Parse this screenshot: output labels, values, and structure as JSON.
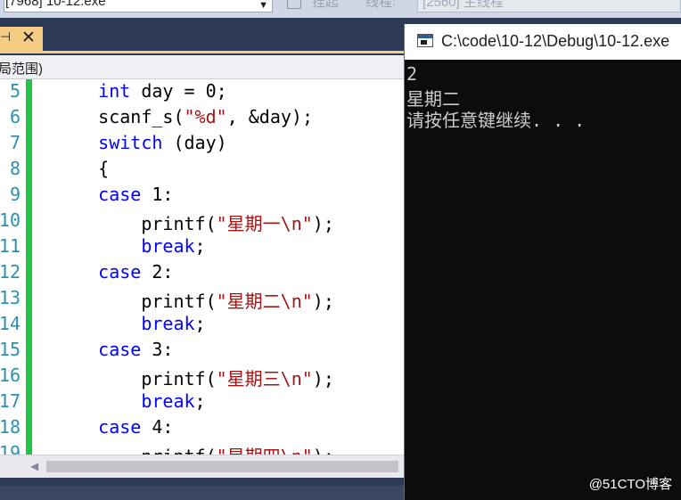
{
  "toolbar": {
    "process_label": "[7968] 10-12.exe",
    "suspend_label": "挂起",
    "thread_label": "线程:",
    "thread_value": "[2560] 主线程"
  },
  "tab": {
    "pin_glyph": "⊣",
    "close_glyph": "✕"
  },
  "scope": {
    "text": "局范围)"
  },
  "editor": {
    "lines": [
      {
        "num": "5",
        "parts": [
          {
            "t": "    "
          },
          {
            "t": "int",
            "c": "kw"
          },
          {
            "t": " day = 0;"
          }
        ]
      },
      {
        "num": "6",
        "parts": [
          {
            "t": "    scanf_s("
          },
          {
            "t": "\"%d\"",
            "c": "str"
          },
          {
            "t": ", &day);"
          }
        ]
      },
      {
        "num": "7",
        "parts": [
          {
            "t": "    "
          },
          {
            "t": "switch",
            "c": "kw"
          },
          {
            "t": " (day)"
          }
        ]
      },
      {
        "num": "8",
        "parts": [
          {
            "t": "    {"
          }
        ]
      },
      {
        "num": "9",
        "parts": [
          {
            "t": "    "
          },
          {
            "t": "case",
            "c": "kw"
          },
          {
            "t": " 1:"
          }
        ]
      },
      {
        "num": "10",
        "parts": [
          {
            "t": "        printf("
          },
          {
            "t": "\"星期一\\n\"",
            "c": "str"
          },
          {
            "t": ");"
          }
        ]
      },
      {
        "num": "11",
        "parts": [
          {
            "t": "        "
          },
          {
            "t": "break",
            "c": "kw"
          },
          {
            "t": ";"
          }
        ]
      },
      {
        "num": "12",
        "parts": [
          {
            "t": "    "
          },
          {
            "t": "case",
            "c": "kw"
          },
          {
            "t": " 2:"
          }
        ]
      },
      {
        "num": "13",
        "parts": [
          {
            "t": "        printf("
          },
          {
            "t": "\"星期二\\n\"",
            "c": "str"
          },
          {
            "t": ");"
          }
        ]
      },
      {
        "num": "14",
        "parts": [
          {
            "t": "        "
          },
          {
            "t": "break",
            "c": "kw"
          },
          {
            "t": ";"
          }
        ]
      },
      {
        "num": "15",
        "parts": [
          {
            "t": "    "
          },
          {
            "t": "case",
            "c": "kw"
          },
          {
            "t": " 3:"
          }
        ]
      },
      {
        "num": "16",
        "parts": [
          {
            "t": "        printf("
          },
          {
            "t": "\"星期三\\n\"",
            "c": "str"
          },
          {
            "t": ");"
          }
        ]
      },
      {
        "num": "17",
        "parts": [
          {
            "t": "        "
          },
          {
            "t": "break",
            "c": "kw"
          },
          {
            "t": ";"
          }
        ]
      },
      {
        "num": "18",
        "parts": [
          {
            "t": "    "
          },
          {
            "t": "case",
            "c": "kw"
          },
          {
            "t": " 4:"
          }
        ]
      },
      {
        "num": "19",
        "parts": [
          {
            "t": "        printf("
          },
          {
            "t": "\"星期四\\n\"",
            "c": "str"
          },
          {
            "t": ");"
          }
        ]
      }
    ],
    "scroll_left_glyph": "◀"
  },
  "console": {
    "title": "C:\\code\\10-12\\Debug\\10-12.exe",
    "output": [
      "2",
      "星期二",
      "请按任意键继续. . ."
    ]
  },
  "watermark": "@51CTO博客"
}
